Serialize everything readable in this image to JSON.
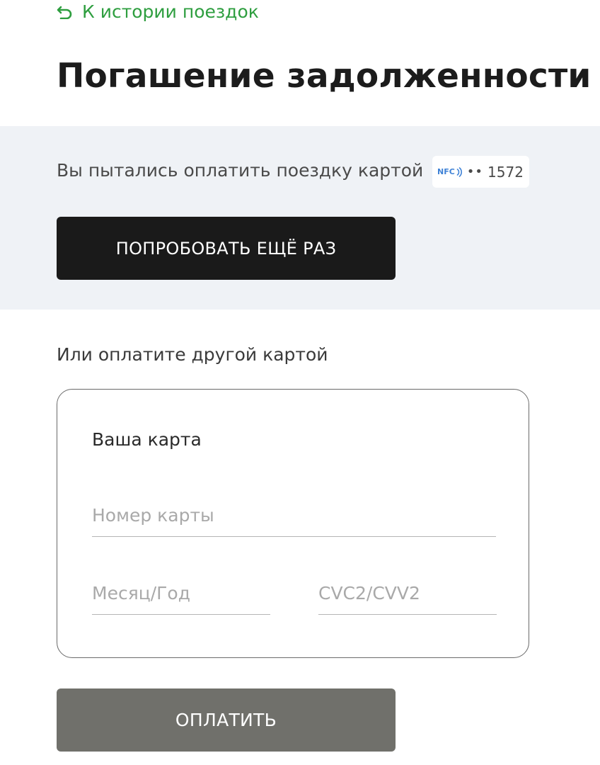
{
  "header": {
    "back_link_label": "К истории поездок",
    "back_icon": "undo-arrow-icon",
    "title": "Погашение задолженности"
  },
  "retry": {
    "message": "Вы пытались оплатить поездку картой",
    "card": {
      "badge": "NFC",
      "icon": "nfc-contactless-icon",
      "masked_dots": "••",
      "last_digits": "1572"
    },
    "retry_button_label": "ПОПРОБОВАТЬ ЕЩЁ РАЗ"
  },
  "other_card": {
    "prompt": "Или оплатите другой картой",
    "form_title": "Ваша карта",
    "card_number": {
      "value": "",
      "placeholder": "Номер карты"
    },
    "expiry": {
      "value": "",
      "placeholder": "Месяц/Год"
    },
    "cvc": {
      "value": "",
      "placeholder": "CVC2/CVV2"
    },
    "pay_button_label": "ОПЛАТИТЬ"
  },
  "colors": {
    "accent_green": "#2e9e3f",
    "panel_bg": "#eff2f6",
    "primary_button": "#1a1a1a",
    "pay_button_disabled": "#70706b",
    "nfc_blue": "#3f82d6"
  }
}
